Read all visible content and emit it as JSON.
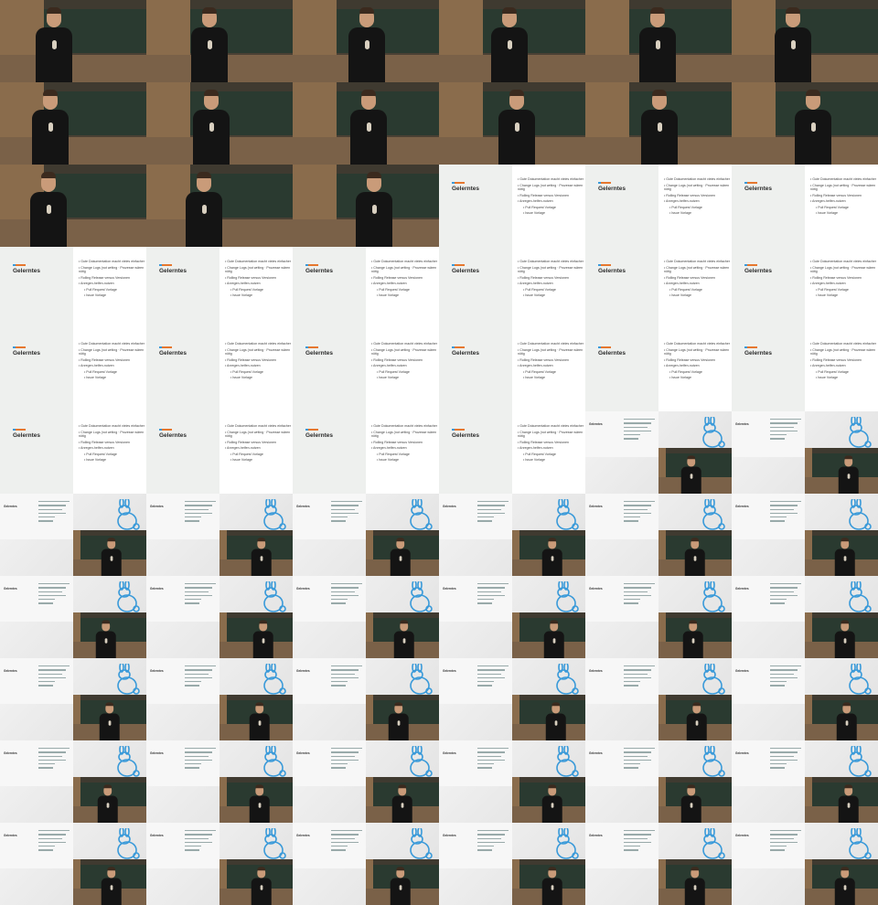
{
  "slide": {
    "title": "Gelerntes",
    "bullets": [
      {
        "text": "Gute Dokumentation macht vieles einfacher",
        "level": 1
      },
      {
        "text": "Change Logs (not writing · Prozesse wären nötig",
        "level": 1
      },
      {
        "text": "Rolling Release versus Versionen",
        "level": 1
      },
      {
        "text": "Anregen-helfen-nutzen",
        "level": 1
      },
      {
        "text": "Pull Request Vorlage",
        "level": 2
      },
      {
        "text": "Issue Vorlage",
        "level": 2
      }
    ]
  },
  "pip_slide": {
    "title": "Gelerntes"
  },
  "colors": {
    "accent_orange": "#e6772e",
    "accent_blue": "#3a9ad9",
    "shirt": "#141414",
    "board": "#2a3a30"
  },
  "frames": [
    "speaker",
    "speaker",
    "speaker",
    "speaker",
    "speaker",
    "speaker",
    "speaker",
    "speaker",
    "speaker",
    "speaker",
    "speaker",
    "speaker",
    "speaker",
    "speaker",
    "speaker",
    "slide",
    "slide",
    "slide",
    "slide",
    "slide",
    "slide",
    "slide",
    "slide",
    "slide",
    "slide",
    "slide",
    "slide",
    "slide",
    "slide",
    "slide",
    "slide",
    "slide",
    "slide",
    "slide",
    "pip",
    "pip",
    "pip",
    "pip",
    "pip",
    "pip",
    "pip",
    "pip",
    "pip",
    "pip",
    "pip",
    "pip",
    "pip",
    "pip",
    "pip",
    "pip",
    "pip",
    "pip",
    "pip",
    "pip",
    "pip",
    "pip",
    "pip",
    "pip",
    "pip",
    "pip",
    "pip",
    "pip",
    "pip",
    "pip",
    "pip",
    "pip"
  ]
}
